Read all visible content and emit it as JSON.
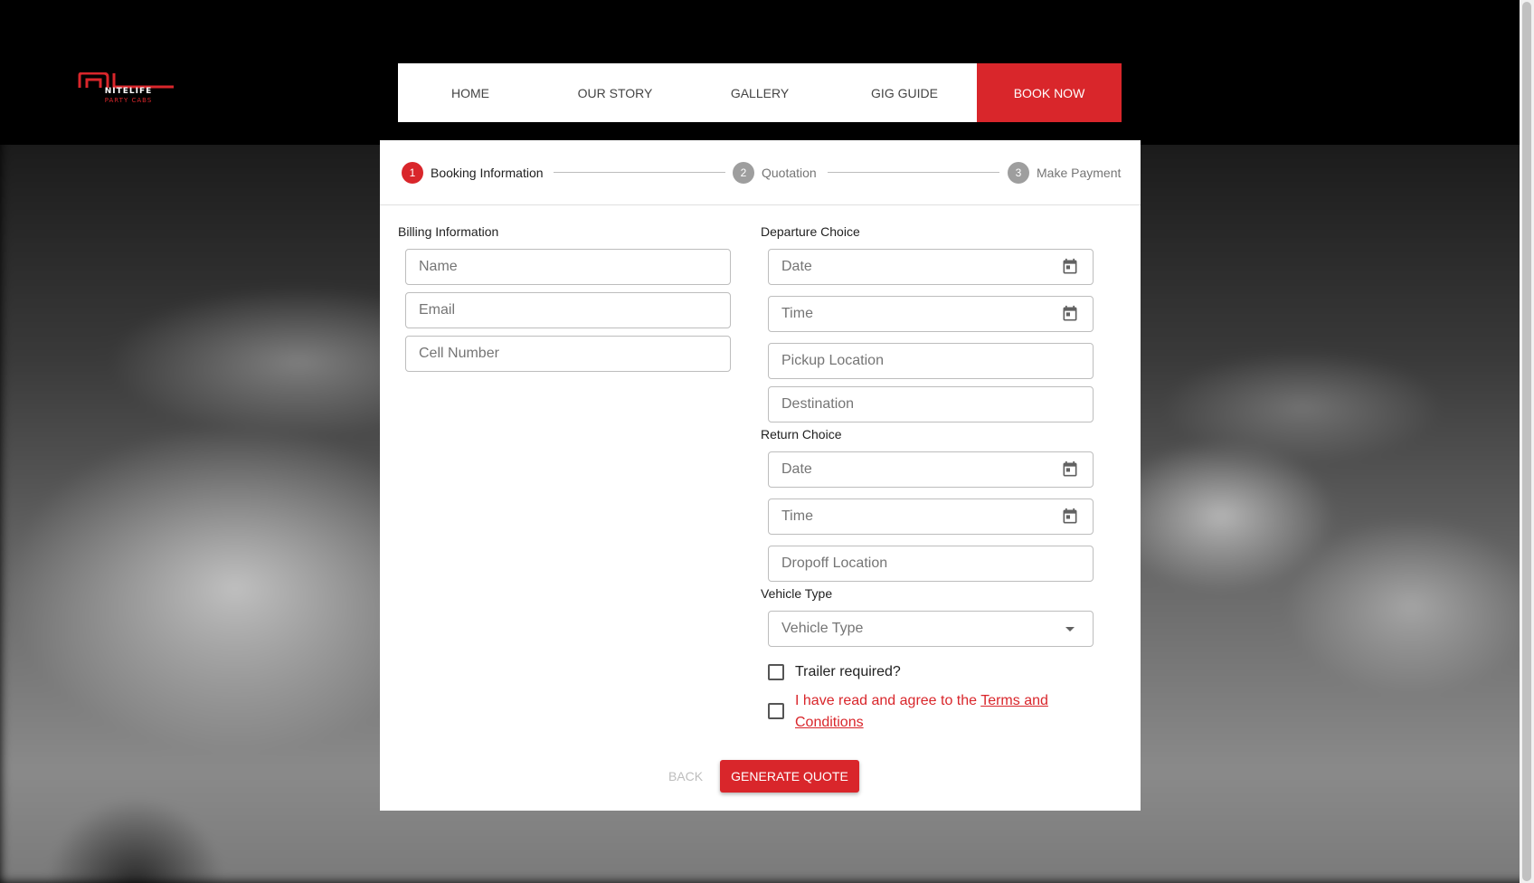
{
  "logo": {
    "monogram": "NL",
    "name": "NITELIFE",
    "tagline": "PARTY CABS"
  },
  "nav": {
    "items": [
      {
        "label": "HOME"
      },
      {
        "label": "OUR STORY"
      },
      {
        "label": "GALLERY"
      },
      {
        "label": "GIG GUIDE"
      },
      {
        "label": "BOOK NOW",
        "active": true
      }
    ]
  },
  "stepper": {
    "steps": [
      {
        "number": "1",
        "label": "Booking Information",
        "active": true
      },
      {
        "number": "2",
        "label": "Quotation"
      },
      {
        "number": "3",
        "label": "Make Payment"
      }
    ]
  },
  "billing": {
    "heading": "Billing Information",
    "name_placeholder": "Name",
    "email_placeholder": "Email",
    "cell_placeholder": "Cell Number"
  },
  "departure": {
    "heading": "Departure Choice",
    "date_placeholder": "Date",
    "time_placeholder": "Time",
    "pickup_placeholder": "Pickup Location",
    "destination_placeholder": "Destination"
  },
  "return_choice": {
    "heading": "Return Choice",
    "date_placeholder": "Date",
    "time_placeholder": "Time",
    "dropoff_placeholder": "Dropoff Location"
  },
  "vehicle": {
    "heading": "Vehicle Type",
    "select_placeholder": "Vehicle Type"
  },
  "trailer": {
    "label": "Trailer required?",
    "checked": false
  },
  "terms": {
    "prefix": "I have read and agree to the ",
    "link_text": "Terms and Conditions",
    "checked": false
  },
  "actions": {
    "back_label": "BACK",
    "generate_label": "GENERATE QUOTE"
  },
  "colors": {
    "accent": "#d9262b",
    "text": "#212121",
    "placeholder": "#757575",
    "border": "#bdbdbd"
  },
  "icons": {
    "date_field": "calendar-icon",
    "time_field": "calendar-icon",
    "vehicle_select": "caret-down-icon"
  }
}
